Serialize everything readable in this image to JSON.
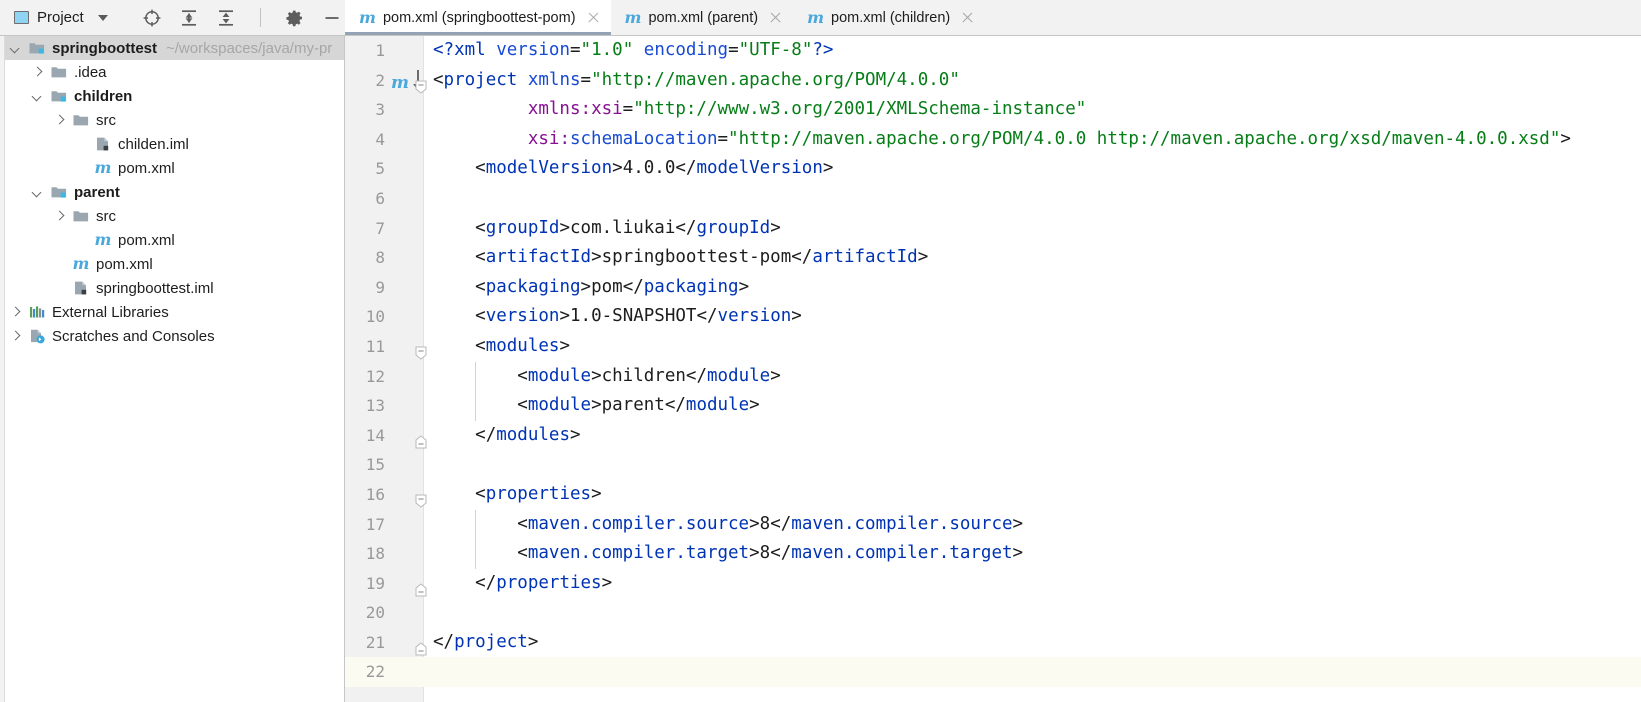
{
  "toolbar": {
    "project_label": "Project",
    "project_icon": "project-window-icon",
    "dropdown_icon": "chevron-down-icon",
    "icons": [
      {
        "name": "locate-target-icon",
        "title": "Select Opened File"
      },
      {
        "name": "expand-all-icon",
        "title": "Expand All"
      },
      {
        "name": "collapse-all-icon",
        "title": "Collapse All"
      },
      {
        "name": "gear-icon",
        "title": "Options"
      },
      {
        "name": "minimize-icon",
        "title": "Hide"
      }
    ]
  },
  "tabs": [
    {
      "label": "pom.xml (springboottest-pom)",
      "icon": "maven-m-icon",
      "active": true,
      "closable": true
    },
    {
      "label": "pom.xml (parent)",
      "icon": "maven-m-icon",
      "active": false,
      "closable": true
    },
    {
      "label": "pom.xml (children)",
      "icon": "maven-m-icon",
      "active": false,
      "closable": true
    }
  ],
  "tree": {
    "items": [
      {
        "label": "springboottest",
        "path": "~/workspaces/java/my-pr",
        "indent": 0,
        "twisty": "down",
        "icon": "module-folder-icon",
        "bold": true,
        "selected": true
      },
      {
        "label": ".idea",
        "path": "",
        "indent": 1,
        "twisty": "right",
        "icon": "folder-icon",
        "bold": false,
        "selected": false
      },
      {
        "label": "children",
        "path": "",
        "indent": 1,
        "twisty": "down",
        "icon": "module-folder-icon",
        "bold": true,
        "selected": false
      },
      {
        "label": "src",
        "path": "",
        "indent": 2,
        "twisty": "right",
        "icon": "folder-icon",
        "bold": false,
        "selected": false
      },
      {
        "label": "childen.iml",
        "path": "",
        "indent": 3,
        "twisty": "none",
        "icon": "iml-file-icon",
        "bold": false,
        "selected": false
      },
      {
        "label": "pom.xml",
        "path": "",
        "indent": 3,
        "twisty": "none",
        "icon": "maven-m-icon",
        "bold": false,
        "selected": false
      },
      {
        "label": "parent",
        "path": "",
        "indent": 1,
        "twisty": "down",
        "icon": "module-folder-icon",
        "bold": true,
        "selected": false
      },
      {
        "label": "src",
        "path": "",
        "indent": 2,
        "twisty": "right",
        "icon": "folder-icon",
        "bold": false,
        "selected": false
      },
      {
        "label": "pom.xml",
        "path": "",
        "indent": 3,
        "twisty": "none",
        "icon": "maven-m-icon",
        "bold": false,
        "selected": false
      },
      {
        "label": "pom.xml",
        "path": "",
        "indent": 2,
        "twisty": "none",
        "icon": "maven-m-icon",
        "bold": false,
        "selected": false
      },
      {
        "label": "springboottest.iml",
        "path": "",
        "indent": 2,
        "twisty": "none",
        "icon": "iml-file-icon",
        "bold": false,
        "selected": false
      },
      {
        "label": "External Libraries",
        "path": "",
        "indent": 0,
        "twisty": "right",
        "icon": "libraries-icon",
        "bold": false,
        "selected": false
      },
      {
        "label": "Scratches and Consoles",
        "path": "",
        "indent": 0,
        "twisty": "right",
        "icon": "scratches-icon",
        "bold": false,
        "selected": false
      }
    ]
  },
  "editor": {
    "caret_line": 22,
    "maven_gutter_line": 2,
    "fold_lines": [
      2,
      11,
      14,
      16,
      19,
      21
    ],
    "lines": [
      {
        "n": 1,
        "indent": 0,
        "tokens": [
          {
            "t": "pi",
            "v": "<?xml"
          },
          {
            "t": "txt",
            "v": " "
          },
          {
            "t": "attr",
            "v": "version"
          },
          {
            "t": "brk",
            "v": "="
          },
          {
            "t": "val",
            "v": "\"1.0\""
          },
          {
            "t": "txt",
            "v": " "
          },
          {
            "t": "attr",
            "v": "encoding"
          },
          {
            "t": "brk",
            "v": "="
          },
          {
            "t": "val",
            "v": "\"UTF-8\""
          },
          {
            "t": "pi",
            "v": "?>"
          }
        ]
      },
      {
        "n": 2,
        "indent": 0,
        "tokens": [
          {
            "t": "brk",
            "v": "<"
          },
          {
            "t": "tag",
            "v": "project"
          },
          {
            "t": "txt",
            "v": " "
          },
          {
            "t": "attr",
            "v": "xmlns"
          },
          {
            "t": "brk",
            "v": "="
          },
          {
            "t": "val",
            "v": "\"http://maven.apache.org/POM/4.0.0\""
          }
        ]
      },
      {
        "n": 3,
        "indent": 0,
        "tokens": [
          {
            "t": "txt",
            "v": "         "
          },
          {
            "t": "ns",
            "v": "xmlns"
          },
          {
            "t": "ns",
            "v": ":"
          },
          {
            "t": "ns",
            "v": "xsi"
          },
          {
            "t": "brk",
            "v": "="
          },
          {
            "t": "val",
            "v": "\"http://www.w3.org/2001/XMLSchema-instance\""
          }
        ]
      },
      {
        "n": 4,
        "indent": 0,
        "tokens": [
          {
            "t": "txt",
            "v": "         "
          },
          {
            "t": "ns",
            "v": "xsi"
          },
          {
            "t": "ns",
            "v": ":"
          },
          {
            "t": "attr",
            "v": "schemaLocation"
          },
          {
            "t": "brk",
            "v": "="
          },
          {
            "t": "val",
            "v": "\"http://maven.apache.org/POM/4.0.0 http://maven.apache.org/xsd/maven-4.0.0.xsd\""
          },
          {
            "t": "brk",
            "v": ">"
          }
        ]
      },
      {
        "n": 5,
        "indent": 0,
        "tokens": [
          {
            "t": "txt",
            "v": "    "
          },
          {
            "t": "brk",
            "v": "<"
          },
          {
            "t": "tag",
            "v": "modelVersion"
          },
          {
            "t": "brk",
            "v": ">"
          },
          {
            "t": "txt",
            "v": "4.0.0"
          },
          {
            "t": "brk",
            "v": "</"
          },
          {
            "t": "tag",
            "v": "modelVersion"
          },
          {
            "t": "brk",
            "v": ">"
          }
        ]
      },
      {
        "n": 6,
        "indent": 0,
        "tokens": []
      },
      {
        "n": 7,
        "indent": 0,
        "tokens": [
          {
            "t": "txt",
            "v": "    "
          },
          {
            "t": "brk",
            "v": "<"
          },
          {
            "t": "tag",
            "v": "groupId"
          },
          {
            "t": "brk",
            "v": ">"
          },
          {
            "t": "txt",
            "v": "com.liukai"
          },
          {
            "t": "brk",
            "v": "</"
          },
          {
            "t": "tag",
            "v": "groupId"
          },
          {
            "t": "brk",
            "v": ">"
          }
        ]
      },
      {
        "n": 8,
        "indent": 0,
        "tokens": [
          {
            "t": "txt",
            "v": "    "
          },
          {
            "t": "brk",
            "v": "<"
          },
          {
            "t": "tag",
            "v": "artifactId"
          },
          {
            "t": "brk",
            "v": ">"
          },
          {
            "t": "txt",
            "v": "springboottest-pom"
          },
          {
            "t": "brk",
            "v": "</"
          },
          {
            "t": "tag",
            "v": "artifactId"
          },
          {
            "t": "brk",
            "v": ">"
          }
        ]
      },
      {
        "n": 9,
        "indent": 0,
        "tokens": [
          {
            "t": "txt",
            "v": "    "
          },
          {
            "t": "brk",
            "v": "<"
          },
          {
            "t": "tag",
            "v": "packaging"
          },
          {
            "t": "brk",
            "v": ">"
          },
          {
            "t": "txt",
            "v": "pom"
          },
          {
            "t": "brk",
            "v": "</"
          },
          {
            "t": "tag",
            "v": "packaging"
          },
          {
            "t": "brk",
            "v": ">"
          }
        ]
      },
      {
        "n": 10,
        "indent": 0,
        "tokens": [
          {
            "t": "txt",
            "v": "    "
          },
          {
            "t": "brk",
            "v": "<"
          },
          {
            "t": "tag",
            "v": "version"
          },
          {
            "t": "brk",
            "v": ">"
          },
          {
            "t": "txt",
            "v": "1.0-SNAPSHOT"
          },
          {
            "t": "brk",
            "v": "</"
          },
          {
            "t": "tag",
            "v": "version"
          },
          {
            "t": "brk",
            "v": ">"
          }
        ]
      },
      {
        "n": 11,
        "indent": 0,
        "tokens": [
          {
            "t": "txt",
            "v": "    "
          },
          {
            "t": "brk",
            "v": "<"
          },
          {
            "t": "tag",
            "v": "modules"
          },
          {
            "t": "brk",
            "v": ">"
          }
        ]
      },
      {
        "n": 12,
        "indent": 0,
        "tokens": [
          {
            "t": "txt",
            "v": "        "
          },
          {
            "t": "brk",
            "v": "<"
          },
          {
            "t": "tag",
            "v": "module"
          },
          {
            "t": "brk",
            "v": ">"
          },
          {
            "t": "txt",
            "v": "children"
          },
          {
            "t": "brk",
            "v": "</"
          },
          {
            "t": "tag",
            "v": "module"
          },
          {
            "t": "brk",
            "v": ">"
          }
        ]
      },
      {
        "n": 13,
        "indent": 0,
        "tokens": [
          {
            "t": "txt",
            "v": "        "
          },
          {
            "t": "brk",
            "v": "<"
          },
          {
            "t": "tag",
            "v": "module"
          },
          {
            "t": "brk",
            "v": ">"
          },
          {
            "t": "txt",
            "v": "parent"
          },
          {
            "t": "brk",
            "v": "</"
          },
          {
            "t": "tag",
            "v": "module"
          },
          {
            "t": "brk",
            "v": ">"
          }
        ]
      },
      {
        "n": 14,
        "indent": 0,
        "tokens": [
          {
            "t": "txt",
            "v": "    "
          },
          {
            "t": "brk",
            "v": "</"
          },
          {
            "t": "tag",
            "v": "modules"
          },
          {
            "t": "brk",
            "v": ">"
          }
        ]
      },
      {
        "n": 15,
        "indent": 0,
        "tokens": []
      },
      {
        "n": 16,
        "indent": 0,
        "tokens": [
          {
            "t": "txt",
            "v": "    "
          },
          {
            "t": "brk",
            "v": "<"
          },
          {
            "t": "tag",
            "v": "properties"
          },
          {
            "t": "brk",
            "v": ">"
          }
        ]
      },
      {
        "n": 17,
        "indent": 0,
        "tokens": [
          {
            "t": "txt",
            "v": "        "
          },
          {
            "t": "brk",
            "v": "<"
          },
          {
            "t": "tag",
            "v": "maven.compiler.source"
          },
          {
            "t": "brk",
            "v": ">"
          },
          {
            "t": "txt",
            "v": "8"
          },
          {
            "t": "brk",
            "v": "</"
          },
          {
            "t": "tag",
            "v": "maven.compiler.source"
          },
          {
            "t": "brk",
            "v": ">"
          }
        ]
      },
      {
        "n": 18,
        "indent": 0,
        "tokens": [
          {
            "t": "txt",
            "v": "        "
          },
          {
            "t": "brk",
            "v": "<"
          },
          {
            "t": "tag",
            "v": "maven.compiler.target"
          },
          {
            "t": "brk",
            "v": ">"
          },
          {
            "t": "txt",
            "v": "8"
          },
          {
            "t": "brk",
            "v": "</"
          },
          {
            "t": "tag",
            "v": "maven.compiler.target"
          },
          {
            "t": "brk",
            "v": ">"
          }
        ]
      },
      {
        "n": 19,
        "indent": 0,
        "tokens": [
          {
            "t": "txt",
            "v": "    "
          },
          {
            "t": "brk",
            "v": "</"
          },
          {
            "t": "tag",
            "v": "properties"
          },
          {
            "t": "brk",
            "v": ">"
          }
        ]
      },
      {
        "n": 20,
        "indent": 0,
        "tokens": []
      },
      {
        "n": 21,
        "indent": 0,
        "tokens": [
          {
            "t": "brk",
            "v": "</"
          },
          {
            "t": "tag",
            "v": "project"
          },
          {
            "t": "brk",
            "v": ">"
          }
        ]
      },
      {
        "n": 22,
        "indent": 0,
        "tokens": []
      }
    ]
  },
  "colors": {
    "tag": "#0033b3",
    "attr_value": "#067d17",
    "namespace": "#871094",
    "maven_blue": "#4aa8dd",
    "selection": "#d6d6d6",
    "caret_line": "#fcfbf2",
    "active_tab_underline": "#93a3b4"
  }
}
